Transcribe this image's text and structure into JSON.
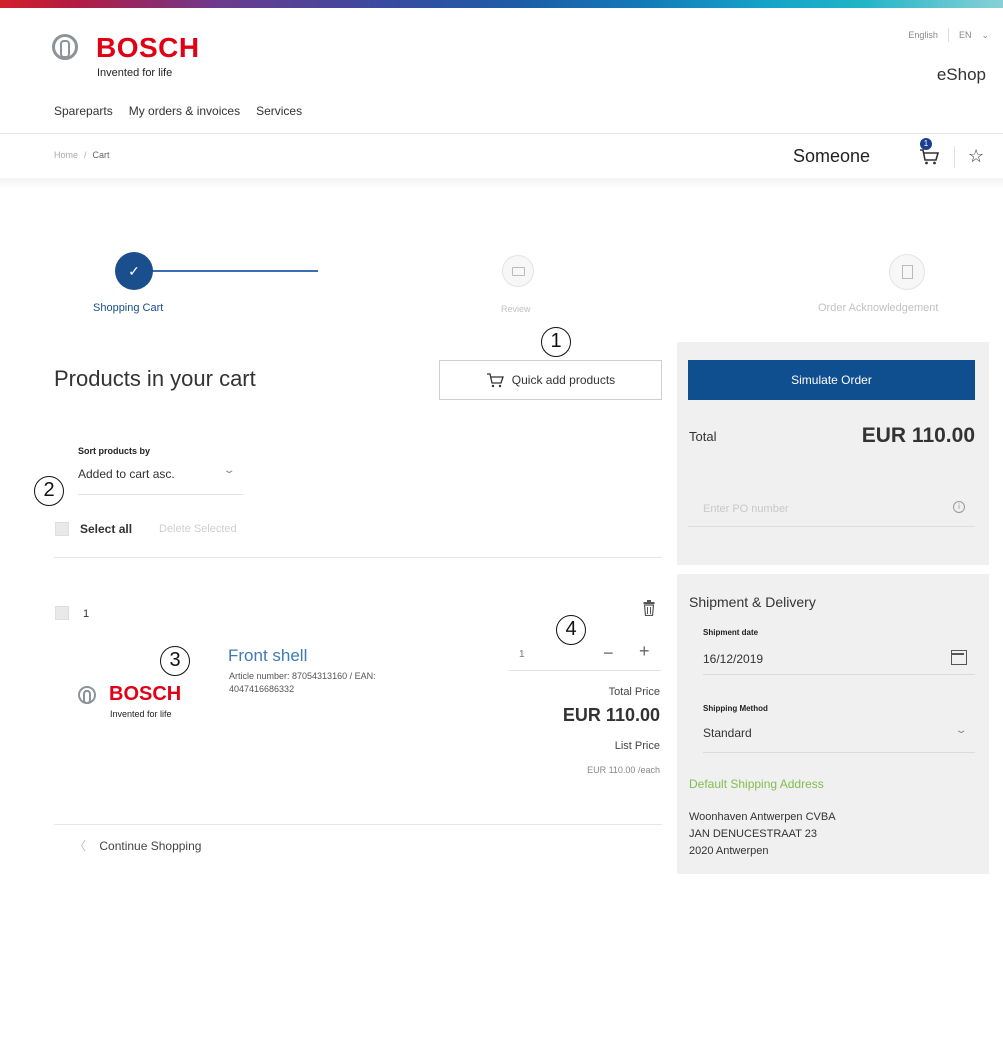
{
  "header": {
    "brand": "BOSCH",
    "tagline": "Invented for life",
    "language": "English",
    "language_code": "EN",
    "shop_name": "eShop",
    "nav": [
      "Spareparts",
      "My orders & invoices",
      "Services"
    ]
  },
  "breadcrumb": [
    "Home",
    "Cart"
  ],
  "user": {
    "name": "Someone",
    "cart_count": "1"
  },
  "stepper": {
    "steps": [
      "Shopping Cart",
      "Review",
      "Order Acknowledgement"
    ],
    "check": "✓"
  },
  "callouts": [
    "1",
    "2",
    "3",
    "4"
  ],
  "cart": {
    "title": "Products in your cart",
    "quick_add": "Quick add products",
    "sort_label": "Sort products by",
    "sort_value": "Added to cart asc.",
    "select_all": "Select all",
    "delete_selected": "Delete Selected",
    "continue": "Continue Shopping",
    "items": [
      {
        "index": "1",
        "brand": "BOSCH",
        "brand_tagline": "Invented for life",
        "name": "Front shell",
        "article": "Article number: 87054313160 / EAN: 4047416686332",
        "quantity": "1",
        "total_price_label": "Total Price",
        "total_price": "EUR 110.00",
        "list_price_label": "List Price",
        "list_price": "EUR 110.00",
        "unit": "/each"
      }
    ]
  },
  "summary": {
    "simulate": "Simulate Order",
    "total_label": "Total",
    "total_value": "EUR 110.00",
    "po_placeholder": "Enter PO number"
  },
  "shipment": {
    "title": "Shipment & Delivery",
    "date_label": "Shipment date",
    "date_value": "16/12/2019",
    "method_label": "Shipping Method",
    "method_value": "Standard",
    "address_title": "Default Shipping Address",
    "address_lines": [
      "Woonhaven Antwerpen CVBA",
      "JAN DENUCESTRAAT 23",
      "2020 Antwerpen"
    ]
  },
  "colors": {
    "brand_red": "#e20015",
    "primary_blue": "#0f4e8f",
    "link_blue": "#3f7ab8",
    "address_green": "#7fbf4d"
  },
  "icons": [
    "shopping-cart-icon",
    "star-icon",
    "check-icon",
    "credit-card-icon",
    "document-icon",
    "quick-add-cart-icon",
    "trash-icon",
    "calendar-icon",
    "info-icon",
    "chevron-down-icon",
    "chevron-left-icon"
  ]
}
